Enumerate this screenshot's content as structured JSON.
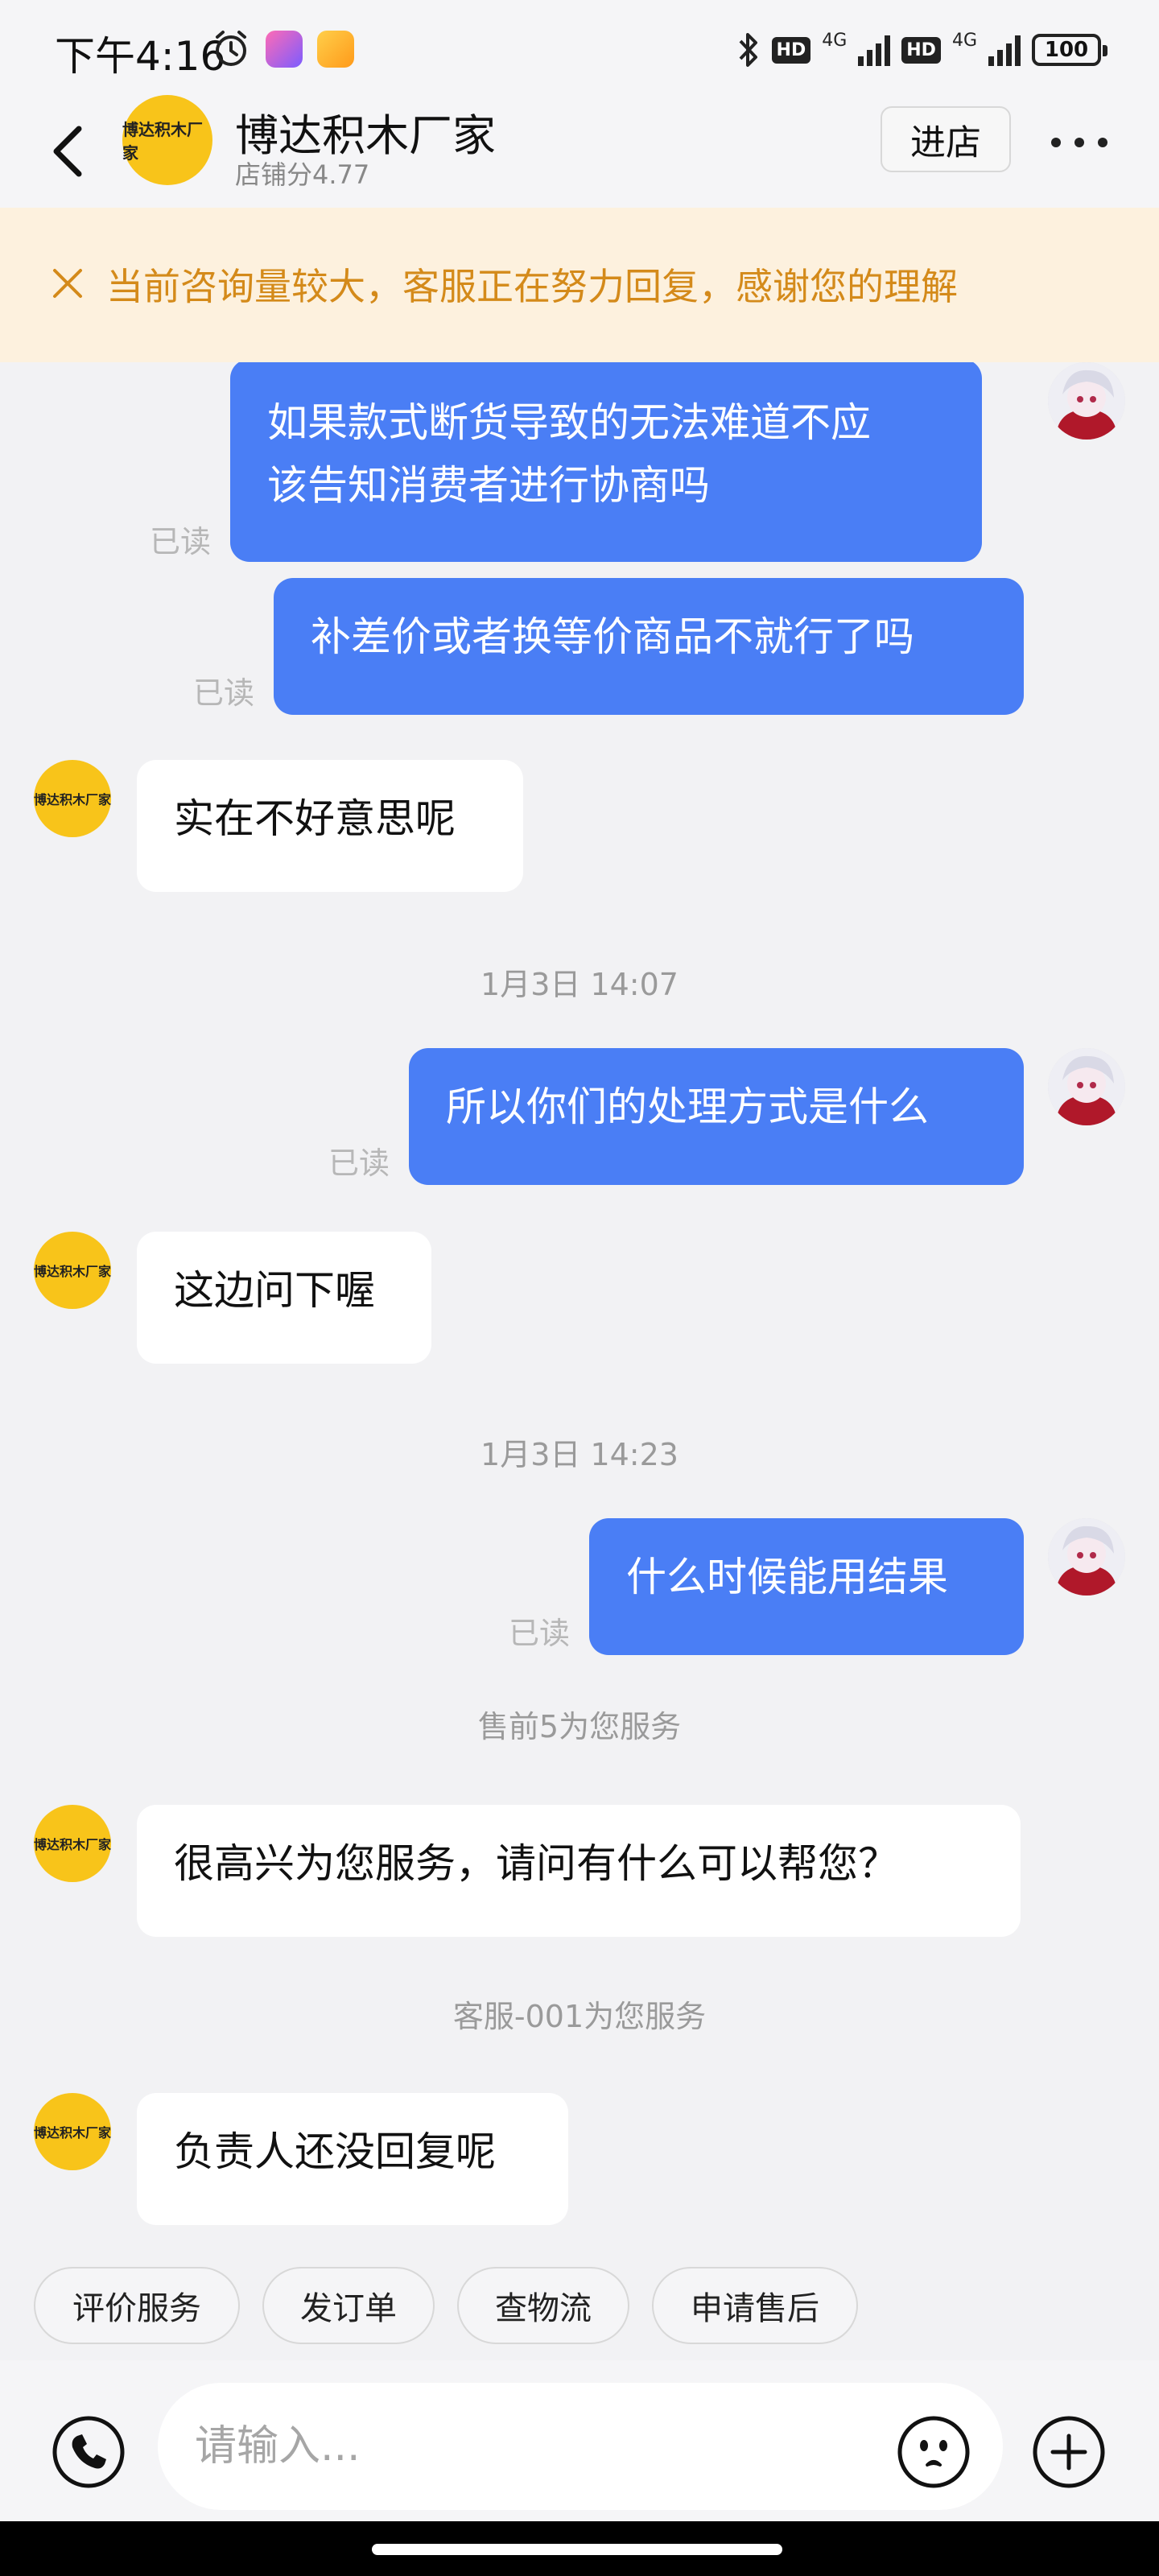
{
  "status_bar": {
    "time": "下午4:16",
    "hd1": "HD",
    "net1": "4G",
    "hd2": "HD",
    "net2": "4G",
    "battery": "100"
  },
  "header": {
    "shop_name": "博达积木厂家",
    "shop_logo_text": "博达积木厂家",
    "shop_score": "店铺分4.77",
    "enter_shop": "进店"
  },
  "notice": {
    "text": "当前咨询量较大，客服正在努力回复，感谢您的理解"
  },
  "messages": [
    {
      "from": "me",
      "lines": [
        "如果款式断货导致的无法难道不应",
        "该告知消费者进行协商吗"
      ],
      "status": "已读"
    },
    {
      "from": "me",
      "text": "补差价或者换等价商品不就行了吗",
      "status": "已读"
    },
    {
      "from": "shop",
      "text": "实在不好意思呢"
    },
    {
      "tip": "1月3日 14:07"
    },
    {
      "from": "me",
      "text": "所以你们的处理方式是什么",
      "status": "已读"
    },
    {
      "from": "shop",
      "text": "这边问下喔"
    },
    {
      "tip": "1月3日 14:23"
    },
    {
      "from": "me",
      "text": "什么时候能用结果",
      "status": "已读"
    },
    {
      "tip": "售前5为您服务"
    },
    {
      "from": "shop",
      "text": "很高兴为您服务，请问有什么可以帮您？"
    },
    {
      "tip": "客服-001为您服务"
    },
    {
      "from": "shop",
      "text": "负责人还没回复呢"
    }
  ],
  "quick_actions": [
    "评价服务",
    "发订单",
    "查物流",
    "申请售后"
  ],
  "input": {
    "placeholder": "请输入..."
  },
  "colors": {
    "my_bubble": "#4a7ef5",
    "shop_avatar": "#f8c41a",
    "notice_bg": "#fdf1de",
    "notice_text": "#d48a1a"
  },
  "icons": [
    "back-icon",
    "more-icon",
    "close-icon",
    "phone-icon",
    "emoji-icon",
    "plus-icon",
    "alarm-icon",
    "bluetooth-icon",
    "signal-icon",
    "battery-icon"
  ]
}
